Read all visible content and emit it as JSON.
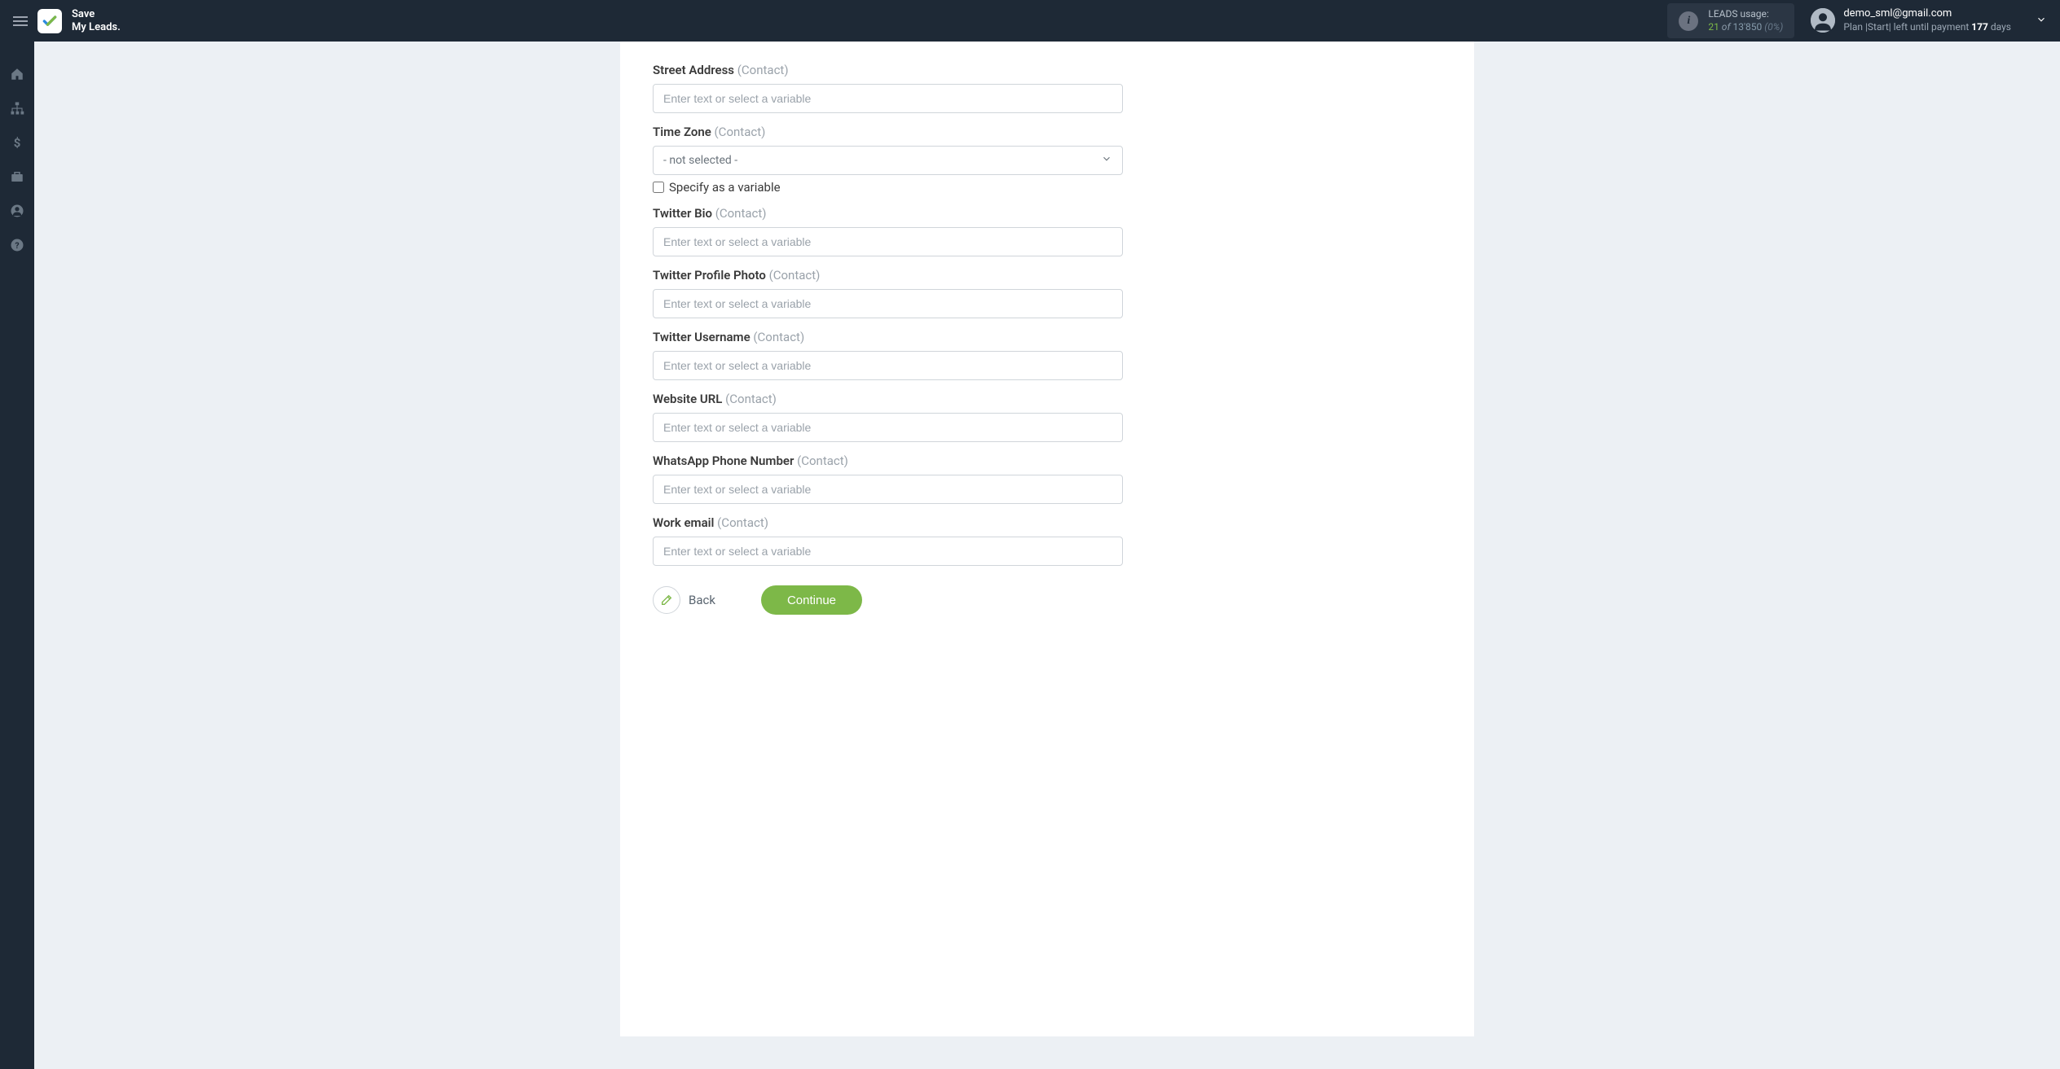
{
  "header": {
    "logo_line1": "Save",
    "logo_line2": "My Leads.",
    "leads_usage_label": "LEADS usage:",
    "leads_current": "21",
    "leads_of": " of ",
    "leads_total": "13'850",
    "leads_pct": " (0%)",
    "user_email": "demo_sml@gmail.com",
    "user_plan_prefix": "Plan |Start| left until payment ",
    "user_plan_days": "177",
    "user_plan_suffix": " days"
  },
  "form": {
    "placeholder": "Enter text or select a variable",
    "select_placeholder": "- not selected -",
    "specify_variable_label": "Specify as a variable",
    "fields": [
      {
        "label": "Street Address",
        "suffix": "(Contact)",
        "type": "text"
      },
      {
        "label": "Time Zone",
        "suffix": "(Contact)",
        "type": "select"
      },
      {
        "label": "Twitter Bio",
        "suffix": "(Contact)",
        "type": "text"
      },
      {
        "label": "Twitter Profile Photo",
        "suffix": "(Contact)",
        "type": "text"
      },
      {
        "label": "Twitter Username",
        "suffix": "(Contact)",
        "type": "text"
      },
      {
        "label": "Website URL",
        "suffix": "(Contact)",
        "type": "text"
      },
      {
        "label": "WhatsApp Phone Number",
        "suffix": "(Contact)",
        "type": "text"
      },
      {
        "label": "Work email",
        "suffix": "(Contact)",
        "type": "text"
      }
    ]
  },
  "buttons": {
    "back": "Back",
    "continue": "Continue"
  }
}
